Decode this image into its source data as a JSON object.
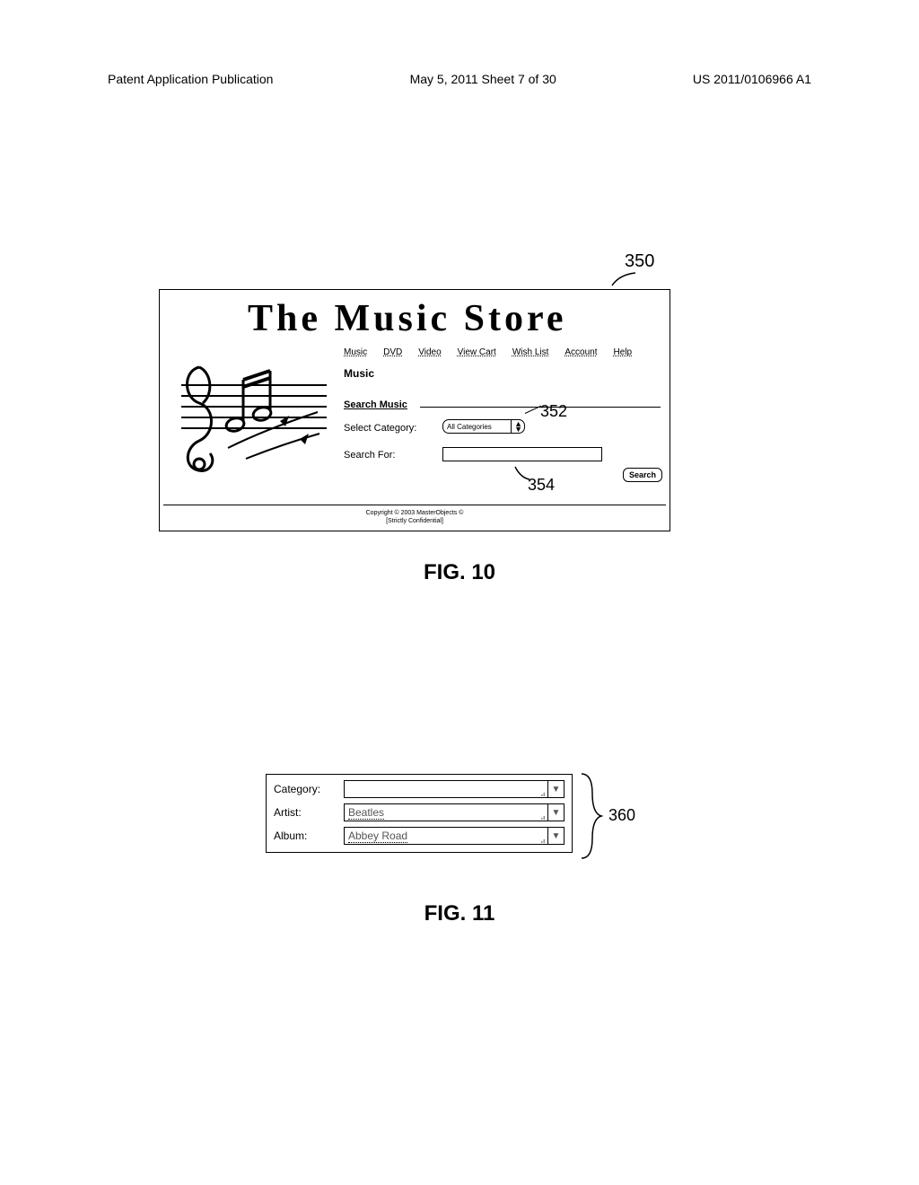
{
  "header": {
    "left": "Patent Application Publication",
    "mid": "May 5, 2011  Sheet 7 of 30",
    "right": "US 2011/0106966 A1"
  },
  "fig10": {
    "ref_main": "350",
    "title": "The Music Store",
    "nav": [
      "Music",
      "DVD",
      "Video",
      "View Cart",
      "Wish List",
      "Account",
      "Help"
    ],
    "section": "Music",
    "search_heading": "Search Music",
    "select_category_label": "Select Category:",
    "select_category_value": "All Categories",
    "search_for_label": "Search For:",
    "search_for_value": "",
    "search_button": "Search",
    "ref_select": "352",
    "ref_input": "354",
    "footer_line1": "Copyright © 2003 MasterObjects ©",
    "footer_line2": "[Strictly Confidential]",
    "caption": "FIG. 10"
  },
  "fig11": {
    "ref": "360",
    "rows": [
      {
        "label": "Category:",
        "value": ""
      },
      {
        "label": "Artist:",
        "value": "Beatles"
      },
      {
        "label": "Album:",
        "value": "Abbey Road"
      }
    ],
    "caption": "FIG. 11"
  }
}
